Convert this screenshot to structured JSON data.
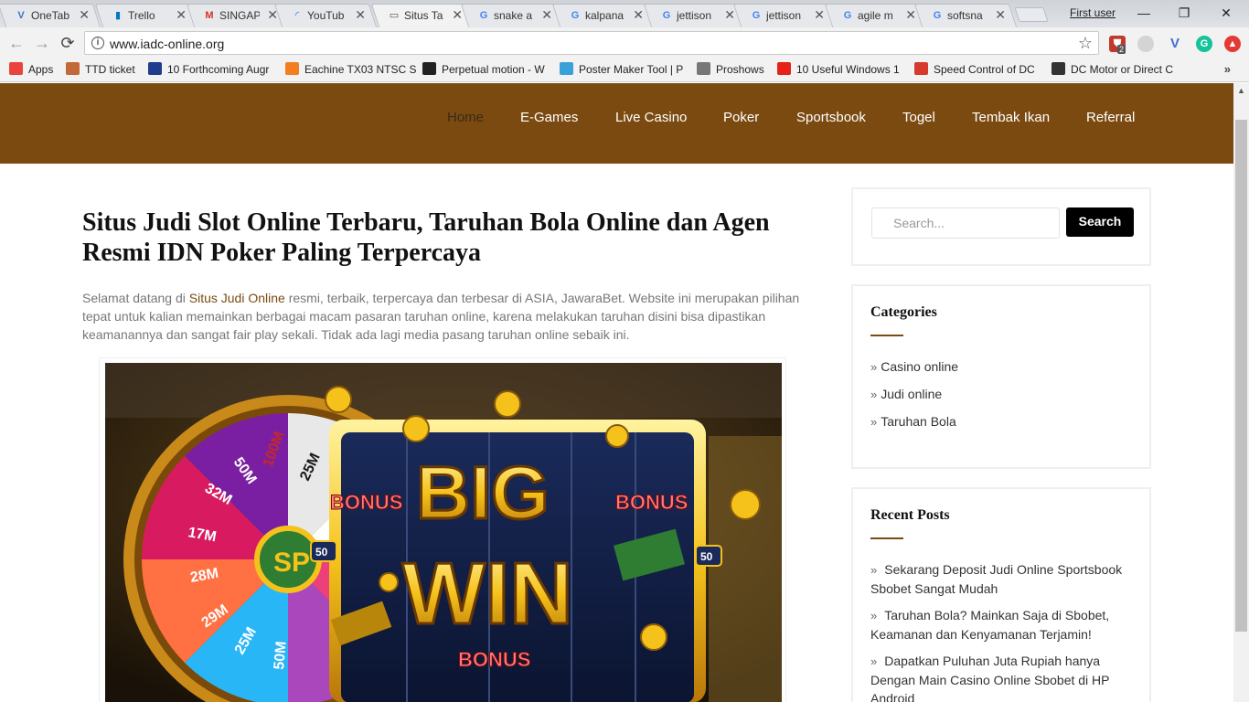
{
  "browser": {
    "tabs": [
      {
        "title": "OneTab",
        "icon_name": "onetab-icon",
        "icon_glyph": "V",
        "icon_color": "#3b74c9",
        "active": false
      },
      {
        "title": "Trello",
        "icon_name": "trello-icon",
        "icon_glyph": "▮",
        "icon_color": "#0079bf",
        "active": false
      },
      {
        "title": "SINGAP",
        "icon_name": "gmail-icon",
        "icon_glyph": "M",
        "icon_color": "#d93025",
        "active": false
      },
      {
        "title": "YouTub",
        "icon_name": "loading-icon",
        "icon_glyph": "◜",
        "icon_color": "#1a73e8",
        "active": false
      },
      {
        "title": "Situs Ta",
        "icon_name": "page-icon",
        "icon_glyph": "▭",
        "icon_color": "#555555",
        "active": true
      },
      {
        "title": "snake a",
        "icon_name": "google-icon",
        "icon_glyph": "G",
        "icon_color": "#4285f4",
        "active": false
      },
      {
        "title": "kalpana",
        "icon_name": "google-icon",
        "icon_glyph": "G",
        "icon_color": "#4285f4",
        "active": false
      },
      {
        "title": "jettison",
        "icon_name": "google-icon",
        "icon_glyph": "G",
        "icon_color": "#4285f4",
        "active": false
      },
      {
        "title": "jettison",
        "icon_name": "google-icon",
        "icon_glyph": "G",
        "icon_color": "#4285f4",
        "active": false
      },
      {
        "title": "agile m",
        "icon_name": "google-icon",
        "icon_glyph": "G",
        "icon_color": "#4285f4",
        "active": false
      },
      {
        "title": "softsna",
        "icon_name": "google-icon",
        "icon_glyph": "G",
        "icon_color": "#4285f4",
        "active": false
      }
    ],
    "tab_close_glyph": "✕",
    "user_name": "First user",
    "window_buttons": {
      "minimize": "—",
      "restore": "❐",
      "close": "✕"
    },
    "nav": {
      "back": "←",
      "forward": "→",
      "reload": "⟳"
    },
    "address": "www.iadc-online.org",
    "extension_badge": "2",
    "bookmarks": [
      {
        "label": "Apps",
        "icon_name": "apps-grid-icon",
        "icon_color": "#e8453c"
      },
      {
        "label": "TTD ticket",
        "icon_name": "ttd-icon",
        "icon_color": "#c2693a"
      },
      {
        "label": "10 Forthcoming Augr",
        "icon_name": "h-icon",
        "icon_color": "#1f3c8f"
      },
      {
        "label": "Eachine TX03 NTSC S",
        "icon_name": "bg-icon",
        "icon_color": "#f27e20"
      },
      {
        "label": "Perpetual motion - W",
        "icon_name": "wikipedia-icon",
        "icon_color": "#222222"
      },
      {
        "label": "Poster Maker Tool | P",
        "icon_name": "poster-icon",
        "icon_color": "#3aa0d8"
      },
      {
        "label": "Proshows",
        "icon_name": "page-icon",
        "icon_color": "#777777"
      },
      {
        "label": "10 Useful Windows 1",
        "icon_name": "youtube-icon",
        "icon_color": "#e62117"
      },
      {
        "label": "Speed Control of DC",
        "icon_name": "flower-icon",
        "icon_color": "#d63a2f"
      },
      {
        "label": "DC Motor or Direct C",
        "icon_name": "dc-icon",
        "icon_color": "#333333"
      }
    ],
    "bookmarks_more": "»"
  },
  "site": {
    "accent_color": "#7b4a11",
    "nav": [
      "Home",
      "E-Games",
      "Live Casino",
      "Poker",
      "Sportsbook",
      "Togel",
      "Tembak Ikan",
      "Referral"
    ],
    "post": {
      "title": "Situs Judi Slot Online Terbaru, Taruhan Bola Online dan Agen Resmi IDN Poker Paling Terpercaya",
      "intro_before": "Selamat datang di ",
      "intro_link": "Situs Judi Online",
      "intro_after": " resmi, terbaik, terpercaya dan terbesar di ASIA, JawaraBet. Website ini merupakan pilihan tepat untuk kalian memainkan berbagai macam pasaran taruhan online, karena melakukan taruhan disini bisa dipastikan keamanannya dan sangat fair play sekali. Tidak ada lagi media pasang taruhan online sebaik ini."
    },
    "banner": {
      "big": "BIG",
      "win": "WIN",
      "bonus": "BONUS",
      "wheel_hub": "SP",
      "wheel_segments": [
        "100M",
        "25M",
        "50M",
        "32M",
        "17M",
        "28M",
        "29M",
        "25M",
        "50M"
      ],
      "reel_number": "50"
    },
    "sidebar": {
      "search_placeholder": "Search...",
      "search_button": "Search",
      "categories_title": "Categories",
      "categories": [
        "Casino online",
        "Judi online",
        "Taruhan Bola"
      ],
      "recent_title": "Recent Posts",
      "recent_posts": [
        "Sekarang Deposit Judi Online Sportsbook Sbobet Sangat Mudah",
        "Taruhan Bola? Mainkan Saja di Sbobet, Keamanan dan Kenyamanan Terjamin!",
        "Dapatkan Puluhan Juta Rupiah hanya Dengan Main Casino Online Sbobet di HP Android"
      ],
      "chevron": "»"
    }
  }
}
